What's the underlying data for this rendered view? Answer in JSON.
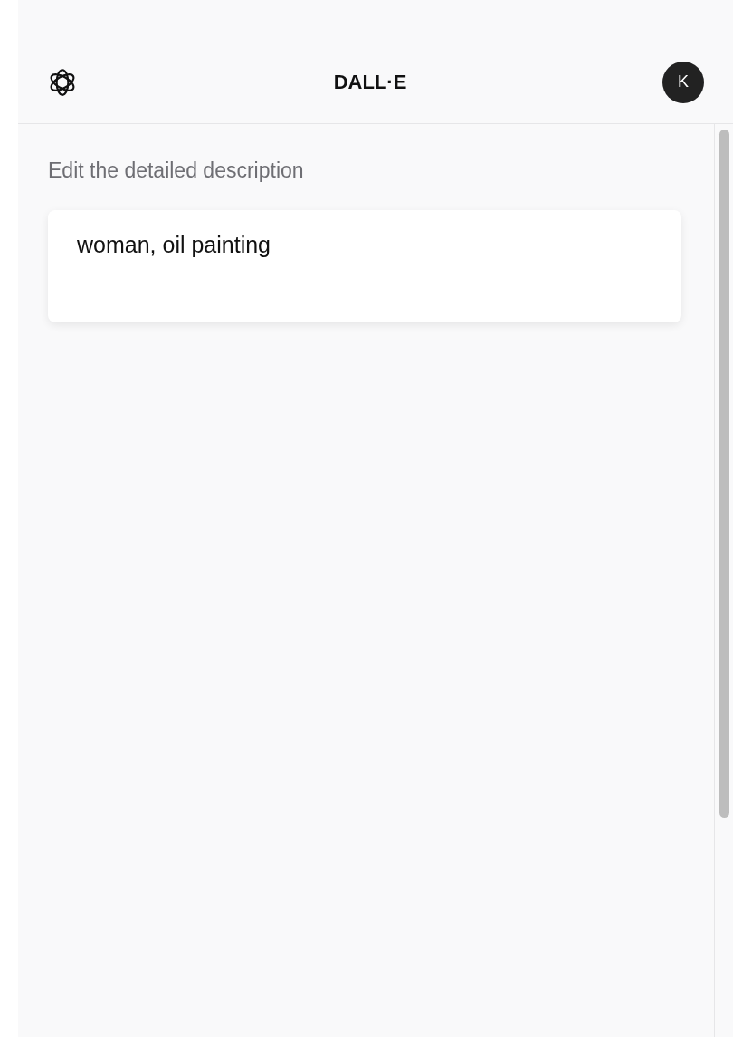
{
  "header": {
    "title": "DALL·E",
    "avatar": "K"
  },
  "editor": {
    "label": "Edit the detailed description",
    "value": "woman, oil painting"
  }
}
